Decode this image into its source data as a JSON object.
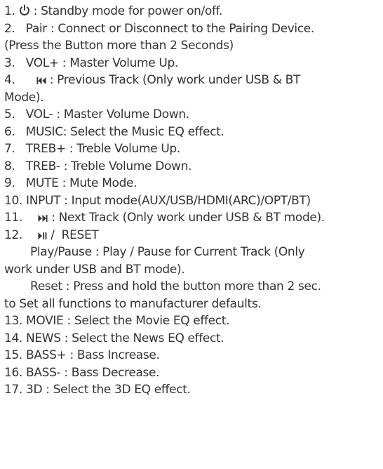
{
  "items": {
    "l1_num": "1.",
    "l1_text": ": Standby mode for power on/off.",
    "l2": "2.   Pair : Connect or Disconnect to the Pairing Device.",
    "l3": "(Press the Button more than 2 Seconds)",
    "l4": "3.   VOL+ : Master Volume Up.",
    "l5_num": "4.",
    "l5_text": ": Previous Track (Only work under USB & BT",
    "l6": "Mode).",
    "l7": "5.   VOL- : Master Volume Down.",
    "l8": "6.   MUSIC: Select the Music EQ effect.",
    "l9": "7.   TREB+ : Treble Volume Up.",
    "l10": "8.   TREB- : Treble Volume Down.",
    "l11": "9.   MUTE : Mute Mode.",
    "l12": "10. INPUT : Input mode(AUX/USB/HDMI(ARC)/OPT/BT)",
    "l13_num": "11.",
    "l13_text": ": Next Track (Only work under USB & BT mode).",
    "l14_num": "12.",
    "l14_text": "/  RESET",
    "l15": "Play/Pause : Play / Pause for Current Track (Only",
    "l16": "work under USB and BT mode).",
    "l17": "Reset : Press and hold the button more than 2 sec.",
    "l18": "to Set all functions to manufacturer defaults.",
    "l19": "13. MOVIE : Select the Movie EQ effect.",
    "l20": "14. NEWS : Select the News EQ effect.",
    "l21": "15. BASS+ : Bass Increase.",
    "l22": "16. BASS- : Bass Decrease.",
    "l23": "17. 3D : Select the 3D EQ effect."
  },
  "icons": {
    "power": "power-icon",
    "previous": "previous-track-icon",
    "next": "next-track-icon",
    "play_pause": "play-pause-icon"
  }
}
